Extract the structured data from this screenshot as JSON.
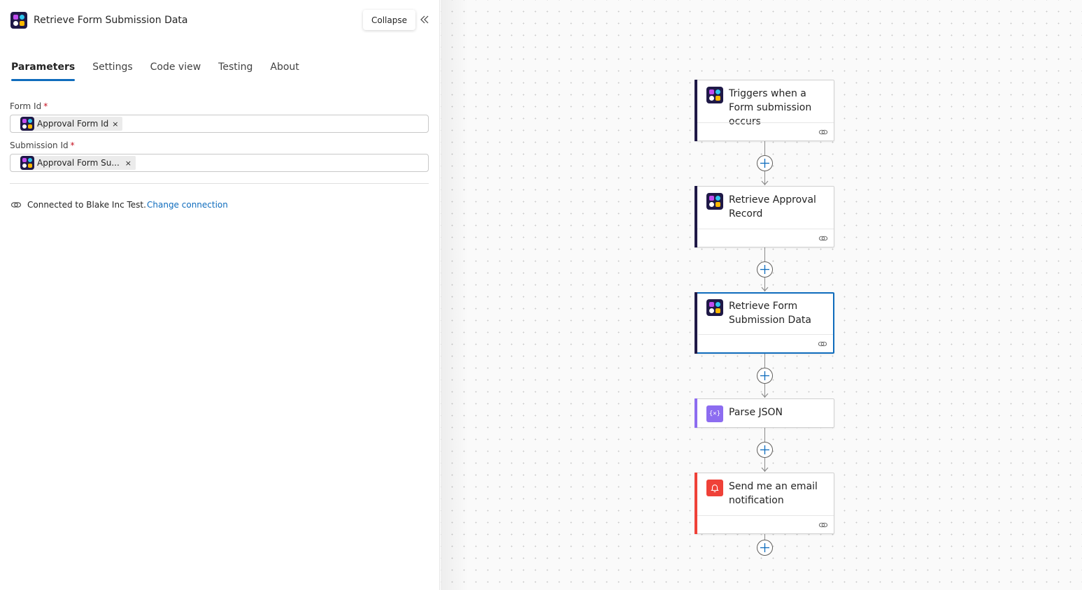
{
  "panel": {
    "title": "Retrieve Form Submission Data",
    "collapse_label": "Collapse",
    "tabs": [
      {
        "label": "Parameters",
        "active": true
      },
      {
        "label": "Settings",
        "active": false
      },
      {
        "label": "Code view",
        "active": false
      },
      {
        "label": "Testing",
        "active": false
      },
      {
        "label": "About",
        "active": false
      }
    ],
    "fields": [
      {
        "label": "Form Id",
        "required_mark": "*",
        "token": "Approval Form Id",
        "token_remove": "×"
      },
      {
        "label": "Submission Id",
        "required_mark": "*",
        "token": "Approval Form Su...",
        "token_remove": "×"
      }
    ],
    "connection_text": "Connected to Blake Inc Test.",
    "change_connection_label": "Change connection"
  },
  "flow": {
    "nodes": [
      {
        "title": "Triggers when a Form submission occurs",
        "icon": "app-icon",
        "accent": "#1f1947",
        "selected": false
      },
      {
        "title": "Retrieve Approval Record",
        "icon": "app-icon",
        "accent": "#1f1947",
        "selected": false
      },
      {
        "title": "Retrieve Form Submission Data",
        "icon": "app-icon",
        "accent": "#1f1947",
        "selected": true
      },
      {
        "title": "Parse JSON",
        "icon": "json-icon",
        "icon_text": "{×}",
        "accent": "#8c6cf0",
        "selected": false
      },
      {
        "title": "Send me an email notification",
        "icon": "bell-icon",
        "accent": "#ef4138",
        "selected": false
      }
    ]
  },
  "colors": {
    "accent_blue": "#0f6cbd",
    "required_red": "#c50f1f"
  }
}
